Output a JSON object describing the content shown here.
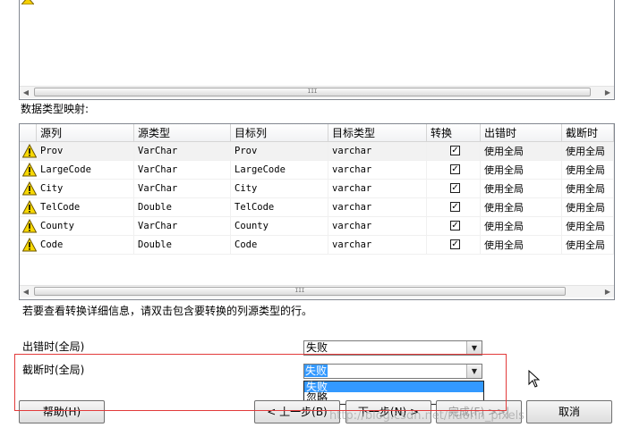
{
  "top_list": {
    "scroll_thumb": "III"
  },
  "mapping_label": "数据类型映射:",
  "grid": {
    "headers": [
      "源列",
      "源类型",
      "目标列",
      "目标类型",
      "转换",
      "出错时",
      "截断时"
    ],
    "rows": [
      {
        "source": "Prov",
        "source_type": "VarChar",
        "target": "Prov",
        "target_type": "varchar",
        "convert": "✓",
        "on_error": "使用全局",
        "on_trunc": "使用全局"
      },
      {
        "source": "LargeCode",
        "source_type": "VarChar",
        "target": "LargeCode",
        "target_type": "varchar",
        "convert": "✓",
        "on_error": "使用全局",
        "on_trunc": "使用全局"
      },
      {
        "source": "City",
        "source_type": "VarChar",
        "target": "City",
        "target_type": "varchar",
        "convert": "✓",
        "on_error": "使用全局",
        "on_trunc": "使用全局"
      },
      {
        "source": "TelCode",
        "source_type": "Double",
        "target": "TelCode",
        "target_type": "varchar",
        "convert": "✓",
        "on_error": "使用全局",
        "on_trunc": "使用全局"
      },
      {
        "source": "County",
        "source_type": "VarChar",
        "target": "County",
        "target_type": "varchar",
        "convert": "✓",
        "on_error": "使用全局",
        "on_trunc": "使用全局"
      },
      {
        "source": "Code",
        "source_type": "Double",
        "target": "Code",
        "target_type": "varchar",
        "convert": "✓",
        "on_error": "使用全局",
        "on_trunc": "使用全局"
      }
    ],
    "scroll_thumb": "III"
  },
  "hint": "若要查看转换详细信息，请双击包含要转换的列源类型的行。",
  "on_error_global": {
    "label": "出错时(全局)",
    "value": "失败"
  },
  "on_trunc_global": {
    "label": "截断时(全局)",
    "value": "失败",
    "options": [
      "失败",
      "忽略"
    ]
  },
  "buttons": {
    "help": "帮助(H)",
    "back": "< 上一步(B)",
    "next": "下一步(N) >",
    "finish": "完成(F) >>|",
    "cancel": "取消"
  },
  "watermark": "http://blog.csdn.net/nuorin_pixels",
  "colors": {
    "selection": "#3399ff",
    "highlight_box": "#e23b3b"
  }
}
